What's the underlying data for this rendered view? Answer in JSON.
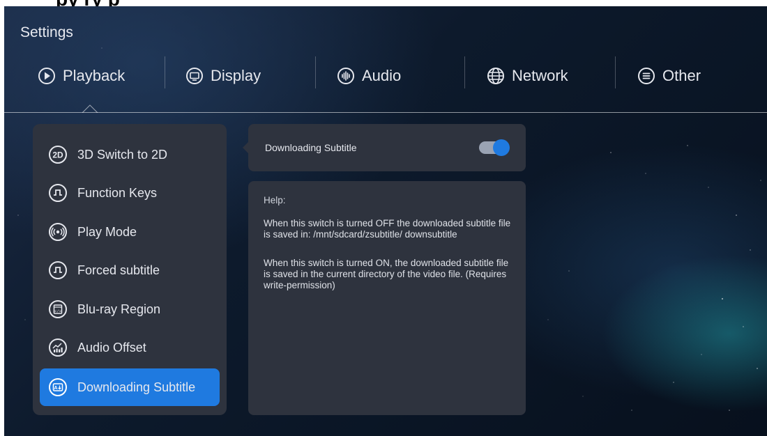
{
  "window": {
    "title": "Settings"
  },
  "banner": {
    "text": "py     ry    p"
  },
  "tabs": [
    {
      "label": "Playback",
      "icon": "play-circle-icon"
    },
    {
      "label": "Display",
      "icon": "monitor-icon"
    },
    {
      "label": "Audio",
      "icon": "audio-wave-icon"
    },
    {
      "label": "Network",
      "icon": "globe-icon"
    },
    {
      "label": "Other",
      "icon": "menu-circle-icon"
    }
  ],
  "sidebar": {
    "items": [
      {
        "label": "3D Switch to 2D",
        "icon": "2d-icon"
      },
      {
        "label": "Function Keys",
        "icon": "function-keys-icon"
      },
      {
        "label": "Play Mode",
        "icon": "play-mode-icon"
      },
      {
        "label": "Forced subtitle",
        "icon": "forced-subtitle-icon"
      },
      {
        "label": "Blu-ray Region",
        "icon": "bluray-region-icon"
      },
      {
        "label": "Audio Offset",
        "icon": "audio-offset-icon"
      },
      {
        "label": "Downloading Subtitle",
        "icon": "download-subtitle-icon",
        "active": true
      }
    ]
  },
  "setting": {
    "label": "Downloading Subtitle",
    "toggle_on": true
  },
  "help": {
    "title": "Help:",
    "paragraphs": [
      " When this switch is turned OFF the downloaded subtitle file is saved in: /mnt/sdcard/zsubtitle/ downsubtitle",
      " When this switch is turned ON, the downloaded subtitle file is saved in the current directory of the video file. (Requires write-permission)"
    ]
  },
  "colors": {
    "accent": "#1f7ae0",
    "panel": "#2e333e"
  }
}
